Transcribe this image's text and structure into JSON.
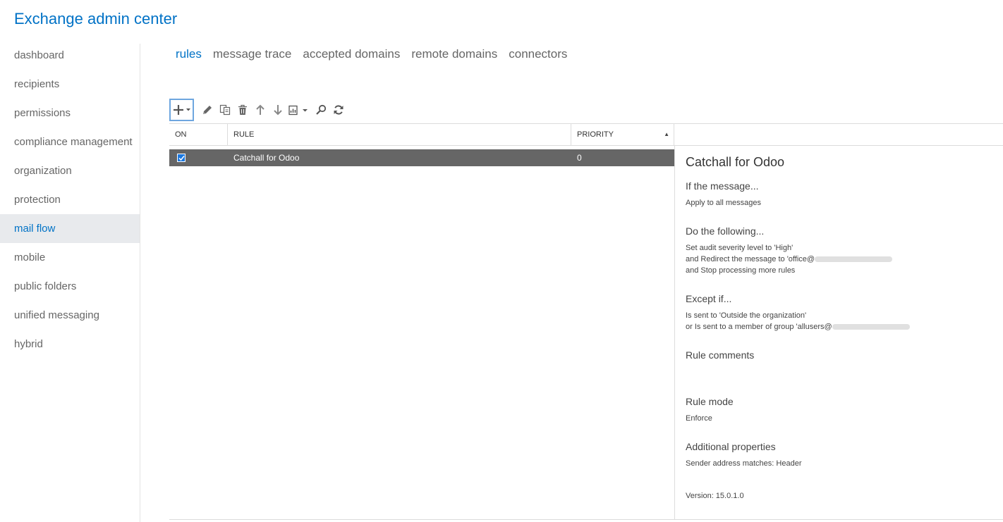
{
  "app": {
    "title": "Exchange admin center"
  },
  "sidebar": {
    "items": [
      {
        "label": "dashboard"
      },
      {
        "label": "recipients"
      },
      {
        "label": "permissions"
      },
      {
        "label": "compliance management"
      },
      {
        "label": "organization"
      },
      {
        "label": "protection"
      },
      {
        "label": "mail flow",
        "active": true
      },
      {
        "label": "mobile"
      },
      {
        "label": "public folders"
      },
      {
        "label": "unified messaging"
      },
      {
        "label": "hybrid"
      }
    ]
  },
  "tabs": [
    {
      "label": "rules",
      "active": true
    },
    {
      "label": "message trace"
    },
    {
      "label": "accepted domains"
    },
    {
      "label": "remote domains"
    },
    {
      "label": "connectors"
    }
  ],
  "toolbar": {
    "icons": [
      "add-icon",
      "edit-icon",
      "copy-icon",
      "delete-icon",
      "move-up-icon",
      "move-down-icon",
      "export-icon",
      "search-icon",
      "refresh-icon"
    ]
  },
  "grid": {
    "columns": {
      "on": "ON",
      "rule": "RULE",
      "priority": "PRIORITY"
    },
    "rows": [
      {
        "on": true,
        "rule": "Catchall for Odoo",
        "priority": "0"
      }
    ]
  },
  "details": {
    "title": "Catchall for Odoo",
    "if_heading": "If the message...",
    "if_lines": [
      "Apply to all messages"
    ],
    "do_heading": "Do the following...",
    "do_lines": [
      "Set audit severity level to 'High'",
      "and Redirect the message to 'office@",
      "and Stop processing more rules"
    ],
    "except_heading": "Except if...",
    "except_lines": [
      "Is sent to 'Outside the organization'",
      "or Is sent to a member of group 'allusers@"
    ],
    "comments_heading": "Rule comments",
    "mode_heading": "Rule mode",
    "mode_value": "Enforce",
    "props_heading": "Additional properties",
    "props_value": "Sender address matches: Header",
    "version": "Version: 15.0.1.0"
  },
  "colors": {
    "accent": "#0072c6",
    "selected_row": "#666666",
    "checkbox": "#1b78e0"
  }
}
